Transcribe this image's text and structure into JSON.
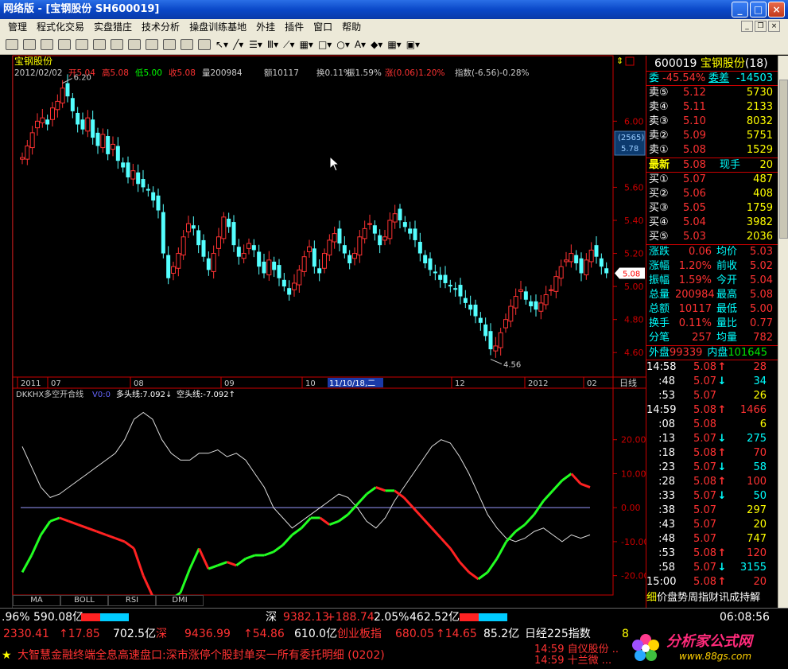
{
  "window": {
    "title": "网络版 - [宝钢股份 SH600019]",
    "min": "_",
    "max": "□",
    "close": "×"
  },
  "menu": [
    "管理",
    "程式化交易",
    "实盘猎庄",
    "技术分析",
    "操盘训练基地",
    "外挂",
    "插件",
    "窗口",
    "帮助"
  ],
  "chart": {
    "stock_name": "宝钢股份",
    "info_line": {
      "date": "2012/02/02",
      "open": "开5.04",
      "high": "高5.08",
      "low": "低5.00",
      "close": "收5.08",
      "vol": "量200984",
      "amount": "额10117",
      "turnover": "换0.11%",
      "amplitude": "振1.59%",
      "change": "涨(0.06)1.20%",
      "index": "指数(-6.56)-0.28%"
    },
    "high_mark": "6.20",
    "low_mark": "4.56",
    "side_box": {
      "count": "(2565)",
      "price": "5.78"
    },
    "current_price_tag": "5.08",
    "period": "日线",
    "cursor_date": "11/10/18,二",
    "x_labels": [
      "2011",
      "07",
      "08",
      "09",
      "10",
      "12",
      "2012",
      "02"
    ],
    "price_axis": [
      "6.00",
      "5.60",
      "5.40",
      "5.20",
      "5.00",
      "4.80",
      "4.60"
    ],
    "indicator": {
      "name": "DKKHX多空开合线",
      "v0": "V0:0",
      "bull": "多头线:7.092↓",
      "bear": "空头线:-7.092↑",
      "axis": [
        "20.00",
        "10.00",
        "0.00",
        "-10.00",
        "-20.00"
      ]
    },
    "tabs": [
      "MA",
      "BOLL",
      "RSI",
      "DMI"
    ]
  },
  "chart_data": [
    {
      "type": "candlestick",
      "title": "宝钢股份",
      "y_ticks": [
        4.6,
        4.8,
        5.0,
        5.2,
        5.4,
        5.6,
        6.0
      ],
      "ylim": [
        4.5,
        6.3
      ],
      "x_labels": [
        "2011",
        "07",
        "08",
        "09",
        "10",
        "12",
        "2012",
        "02"
      ],
      "close": [
        5.78,
        5.85,
        5.93,
        6.0,
        6.02,
        5.98,
        6.08,
        6.12,
        6.2,
        6.15,
        6.06,
        5.98,
        5.95,
        6.02,
        5.9,
        5.85,
        5.92,
        5.8,
        5.86,
        5.76,
        5.72,
        5.66,
        5.7,
        5.62,
        5.6,
        5.58,
        5.52,
        5.46,
        5.2,
        5.05,
        5.12,
        5.2,
        5.3,
        5.38,
        5.35,
        5.25,
        5.18,
        5.1,
        5.2,
        5.3,
        5.42,
        5.36,
        5.25,
        5.18,
        5.2,
        5.26,
        5.22,
        5.12,
        5.08,
        5.16,
        5.1,
        5.05,
        5.0,
        4.95,
        5.02,
        5.1,
        5.18,
        5.24,
        5.12,
        5.08,
        5.2,
        5.28,
        5.32,
        5.26,
        5.2,
        5.14,
        5.2,
        5.3,
        5.35,
        5.38,
        5.32,
        5.25,
        5.3,
        5.4,
        5.44,
        5.4,
        5.36,
        5.32,
        5.28,
        5.2,
        5.14,
        5.1,
        5.08,
        5.04,
        5.02,
        5.0,
        4.98,
        4.94,
        4.9,
        4.86,
        4.82,
        4.78,
        4.7,
        4.62,
        4.64,
        4.72,
        4.8,
        4.88,
        4.94,
        4.98,
        4.92,
        4.88,
        4.86,
        4.9,
        4.95,
        4.98,
        5.06,
        5.12,
        5.16,
        5.2,
        5.14,
        5.08,
        5.16,
        5.22,
        5.18,
        5.12,
        5.08
      ]
    },
    {
      "type": "line",
      "title": "DKKHX多空开合线",
      "ylim": [
        -25,
        30
      ],
      "y_ticks": [
        -20,
        -10,
        0,
        10,
        20
      ],
      "series": [
        {
          "name": "多头线",
          "values": [
            -19,
            -14,
            -8,
            -4,
            -3,
            -4,
            -5,
            -6,
            -7,
            -8,
            -9,
            -10,
            -12,
            -20,
            -26,
            -28,
            -27,
            -25,
            -18,
            -12,
            -18,
            -17,
            -16,
            -17,
            -15,
            -14,
            -14,
            -13,
            -11,
            -8,
            -6,
            -3,
            -3,
            -5,
            -4,
            -2,
            1,
            4,
            6,
            5,
            5,
            3,
            0,
            -3,
            -6,
            -9,
            -12,
            -16,
            -19,
            -21,
            -19,
            -15,
            -10,
            -7,
            -5,
            -2,
            2,
            5,
            8,
            10,
            7,
            6
          ]
        },
        {
          "name": "空头线",
          "values": [
            18,
            12,
            6,
            3,
            4,
            6,
            8,
            10,
            12,
            14,
            16,
            20,
            26,
            28,
            26,
            20,
            16,
            14,
            14,
            16,
            16,
            17,
            15,
            16,
            14,
            10,
            6,
            0,
            -3,
            -6,
            -4,
            -2,
            0,
            2,
            4,
            3,
            0,
            -4,
            -6,
            -3,
            2,
            6,
            10,
            14,
            18,
            20,
            19,
            15,
            10,
            4,
            -2,
            -6,
            -9,
            -10,
            -9,
            -7,
            -6,
            -8,
            -10,
            -8,
            -9,
            -8
          ]
        }
      ]
    }
  ],
  "quote": {
    "code": "600019",
    "name": "宝钢股份",
    "num": "(18)",
    "weibi_label": "委",
    "weibi": "-45.54%",
    "weicha_label": "委差",
    "weicha": "-14503",
    "sells": [
      {
        "label": "卖⑤",
        "price": "5.12",
        "vol": "5730"
      },
      {
        "label": "卖④",
        "price": "5.11",
        "vol": "2133"
      },
      {
        "label": "卖③",
        "price": "5.10",
        "vol": "8032"
      },
      {
        "label": "卖②",
        "price": "5.09",
        "vol": "5751"
      },
      {
        "label": "卖①",
        "price": "5.08",
        "vol": "1529"
      }
    ],
    "latest_label": "最新",
    "latest": "5.08",
    "current_hand_label": "现手",
    "current_hand": "20",
    "buys": [
      {
        "label": "买①",
        "price": "5.07",
        "vol": "487"
      },
      {
        "label": "买②",
        "price": "5.06",
        "vol": "408"
      },
      {
        "label": "买③",
        "price": "5.05",
        "vol": "1759"
      },
      {
        "label": "买④",
        "price": "5.04",
        "vol": "3982"
      },
      {
        "label": "买⑤",
        "price": "5.03",
        "vol": "2036"
      }
    ],
    "stats": [
      {
        "k": "涨跌",
        "v": "0.06",
        "k2": "均价",
        "v2": "5.03"
      },
      {
        "k": "涨幅",
        "v": "1.20%",
        "k2": "前收",
        "v2": "5.02"
      },
      {
        "k": "振幅",
        "v": "1.59%",
        "k2": "今开",
        "v2": "5.04"
      },
      {
        "k": "总量",
        "v": "200984",
        "k2": "最高",
        "v2": "5.08"
      },
      {
        "k": "总额",
        "v": "10117",
        "k2": "最低",
        "v2": "5.00"
      },
      {
        "k": "换手",
        "v": "0.11%",
        "k2": "量比",
        "v2": "0.77"
      },
      {
        "k": "分笔",
        "v": "257",
        "k2": "均量",
        "v2": "782"
      }
    ],
    "outer_label": "外盘",
    "outer": "99339",
    "inner_label": "内盘",
    "inner": "101645",
    "ticks": [
      {
        "t": "14:58",
        "p": "5.08",
        "d": "up",
        "v": "28"
      },
      {
        "t": ":48",
        "p": "5.07",
        "d": "down",
        "v": "34"
      },
      {
        "t": ":53",
        "p": "5.07",
        "d": "",
        "v": "26"
      },
      {
        "t": "14:59",
        "p": "5.08",
        "d": "up",
        "v": "1466"
      },
      {
        "t": ":08",
        "p": "5.08",
        "d": "",
        "v": "6"
      },
      {
        "t": ":13",
        "p": "5.07",
        "d": "down",
        "v": "275"
      },
      {
        "t": ":18",
        "p": "5.08",
        "d": "up",
        "v": "70"
      },
      {
        "t": ":23",
        "p": "5.07",
        "d": "down",
        "v": "58"
      },
      {
        "t": ":28",
        "p": "5.08",
        "d": "up",
        "v": "100"
      },
      {
        "t": ":33",
        "p": "5.07",
        "d": "down",
        "v": "50"
      },
      {
        "t": ":38",
        "p": "5.07",
        "d": "",
        "v": "297"
      },
      {
        "t": ":43",
        "p": "5.07",
        "d": "",
        "v": "20"
      },
      {
        "t": ":48",
        "p": "5.07",
        "d": "",
        "v": "747"
      },
      {
        "t": ":53",
        "p": "5.08",
        "d": "up",
        "v": "120"
      },
      {
        "t": ":58",
        "p": "5.07",
        "d": "down",
        "v": "3155"
      },
      {
        "t": "15:00",
        "p": "5.08",
        "d": "up",
        "v": "20"
      }
    ],
    "footer": [
      "细",
      "价",
      "盘",
      "势",
      "周",
      "指",
      "财",
      "讯",
      "成",
      "持",
      "解"
    ]
  },
  "status": {
    "line1": {
      "left": ".96% 590.08亿",
      "sz_label": "深",
      "sz_index": "9382.13",
      "sz_chg": "+188.74",
      "sz_pct": "2.05%",
      "sz_amt": "462.52亿",
      "time": "06:08:56"
    },
    "line2": {
      "a": "2330.41",
      "b": "↑17.85",
      "c": "702.5亿",
      "d": "深",
      "e": "9436.99",
      "f": "↑54.86",
      "g": "610.0亿",
      "h": "创业板指",
      "i": "680.05",
      "j": "↑14.65",
      "k": "85.2亿",
      "l": "日经225指数",
      "m": "8"
    },
    "line3": {
      "star": "★",
      "ticker": "大智慧金融终端全息高速盘口:深市涨停个股封单买一所有委托明细 (0202)",
      "t1": "14:59 自仪股份 ..",
      "t2": "14:59 十兰微 ..."
    }
  },
  "logo": {
    "text": "分析家公式网",
    "url": "www.88gs.com"
  }
}
